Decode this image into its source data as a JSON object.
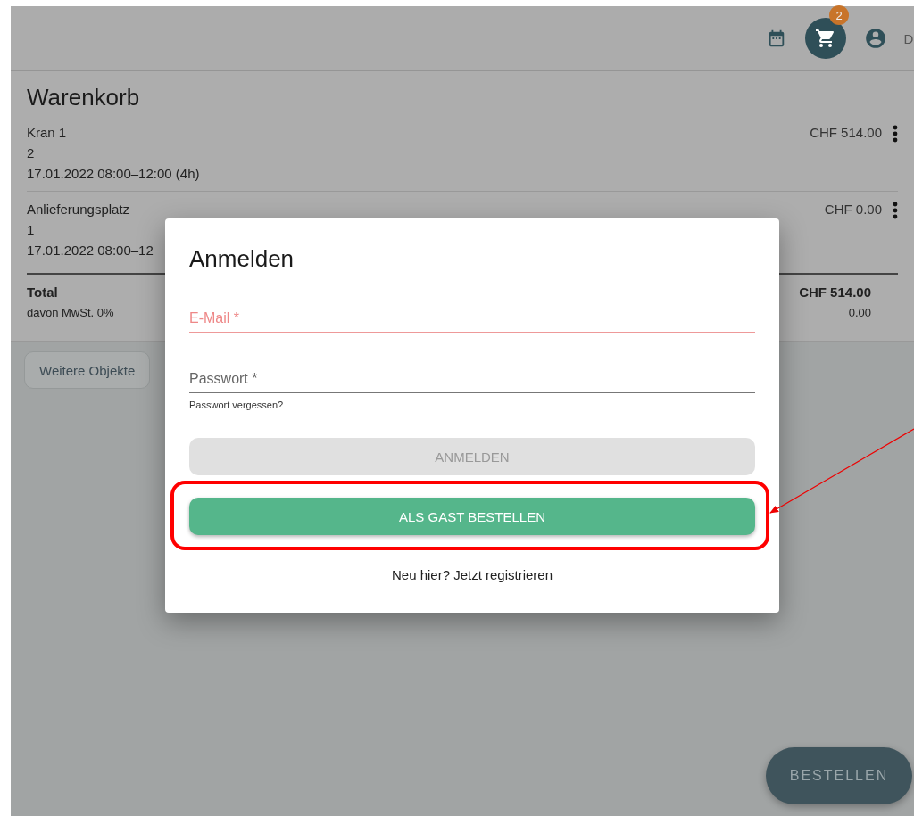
{
  "header": {
    "cart_badge": "2",
    "language": "D"
  },
  "cart": {
    "title": "Warenkorb",
    "items": [
      {
        "name": "Kran 1",
        "quantity": "2",
        "date": "17.01.2022 08:00–12:00 (4h)",
        "price": "CHF 514.00"
      },
      {
        "name": "Anlieferungsplatz",
        "quantity": "1",
        "date": "17.01.2022 08:00–12",
        "price": "CHF 0.00"
      }
    ],
    "total": {
      "label": "Total",
      "amount": "CHF 514.00",
      "vat_label": "davon MwSt. 0%",
      "vat_amount": "0.00"
    }
  },
  "more_button": "Weitere Objekte",
  "dialog": {
    "title": "Anmelden",
    "email": {
      "placeholder": "E-Mail *",
      "error": true
    },
    "password": {
      "placeholder": "Passwort *",
      "error": false
    },
    "forgot_link": "Passwort vergessen?",
    "login_button": {
      "label": "ANMELDEN",
      "disabled": true
    },
    "guest_button": {
      "label": "ALS GAST BESTELLEN",
      "disabled": false
    },
    "register_link": "Neu hier? Jetzt registrieren"
  },
  "order_button": "BESTELLEN"
}
